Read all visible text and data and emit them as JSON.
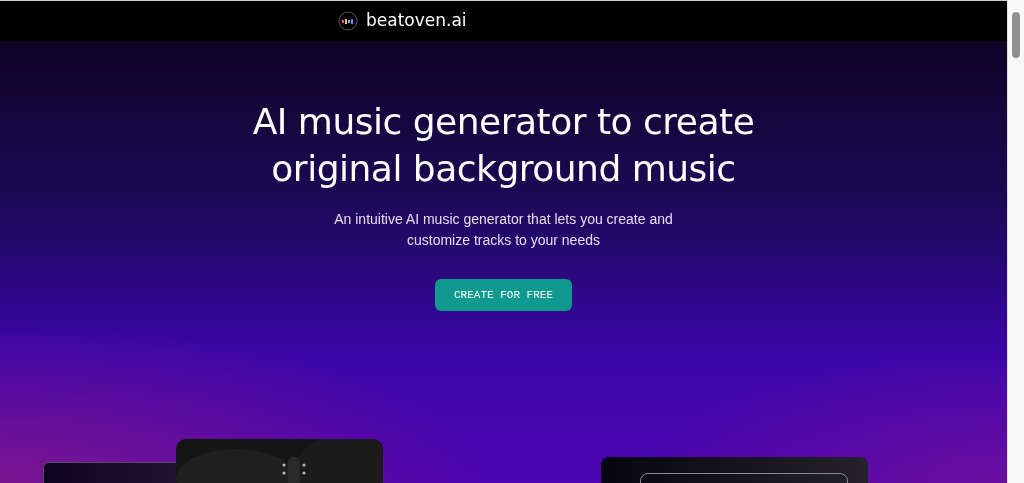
{
  "navbar": {
    "brand": "beatoven.ai"
  },
  "hero": {
    "title": "AI music generator to create original background music",
    "subtitle": "An intuitive AI music generator that lets you create and customize tracks to your needs",
    "cta": "CREATE FOR FREE"
  },
  "showcase": [
    {
      "kind": "panel"
    },
    {
      "kind": "picture"
    },
    {
      "kind": "prompt"
    }
  ]
}
